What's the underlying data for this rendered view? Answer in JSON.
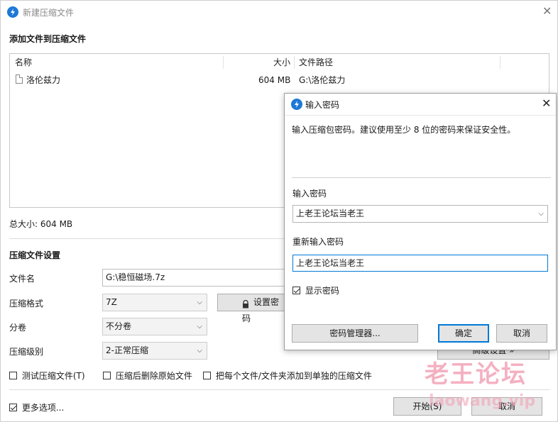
{
  "window": {
    "title": "新建压缩文件",
    "icon": "app-bolt-icon"
  },
  "section_add": "添加文件到压缩文件",
  "file_list": {
    "columns": {
      "name": "名称",
      "size": "大小",
      "path": "文件路径"
    },
    "rows": [
      {
        "name": "洛伦兹力",
        "size": "604 MB",
        "path": "G:\\洛伦兹力"
      }
    ]
  },
  "total_size": "总大小: 604 MB",
  "settings": {
    "title": "压缩文件设置",
    "filename_label": "文件名",
    "filename_value": "G:\\稳恒磁场.7z",
    "format_label": "压缩格式",
    "format_value": "7Z",
    "set_password_button": "设置密码",
    "split_label": "分卷",
    "split_value": "不分卷",
    "level_label": "压缩级别",
    "level_value": "2-正常压缩",
    "advanced_button": "高级设置 »",
    "opt_test": "测试压缩文件(T)",
    "opt_delete": "压缩后删除原始文件",
    "opt_each": "把每个文件/文件夹添加到单独的压缩文件"
  },
  "more_options": "更多选项...",
  "start_button": "开始(S)",
  "cancel_button": "取消",
  "password_dialog": {
    "title": "输入密码",
    "hint": "输入压缩包密码。建议使用至少 8 位的密码来保证安全性。",
    "password_label": "输入密码",
    "password_value": "上老王论坛当老王",
    "confirm_label": "重新输入密码",
    "confirm_value": "上老王论坛当老王",
    "show_password": "显示密码",
    "manager_button": "密码管理器...",
    "ok_button": "确定",
    "cancel_button": "取消"
  },
  "watermark": {
    "text": "老王论坛",
    "url": "laowang.vip"
  },
  "colors": {
    "accent": "#1e78d6",
    "focus_border": "#0078d7",
    "ok_border": "#0078d7",
    "watermark": "#f3a3b7"
  }
}
